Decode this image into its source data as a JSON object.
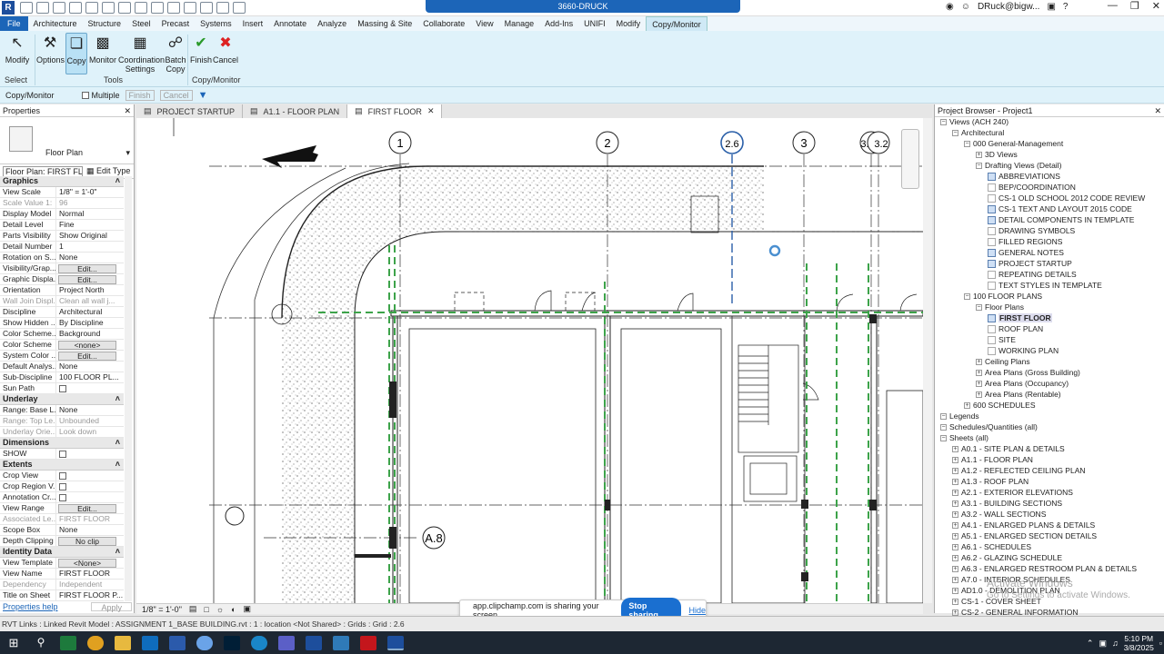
{
  "title_bar": {
    "document": "3660-DRUCK",
    "user": "DRuck@bigw...",
    "revit_letter": "R"
  },
  "ribbon_tabs": [
    "File",
    "Architecture",
    "Structure",
    "Steel",
    "Precast",
    "Systems",
    "Insert",
    "Annotate",
    "Analyze",
    "Massing & Site",
    "Collaborate",
    "View",
    "Manage",
    "Add-Ins",
    "UNIFI",
    "Modify",
    "Copy/Monitor"
  ],
  "ribbon": {
    "modify": "Modify",
    "options": "Options",
    "copy": "Copy",
    "monitor": "Monitor",
    "coordination_settings": "Coordination Settings",
    "batch_copy": "Batch Copy",
    "finish": "Finish",
    "cancel": "Cancel",
    "panel_select": "Select",
    "panel_tools": "Tools",
    "panel_copy_monitor": "Copy/Monitor"
  },
  "options_bar": {
    "label": "Copy/Monitor",
    "multiple": "Multiple",
    "finish": "Finish",
    "cancel": "Cancel"
  },
  "properties": {
    "title": "Properties",
    "type_name": "Floor Plan",
    "selector": "Floor Plan: FIRST FLO",
    "edit_type": "Edit Type",
    "help": "Properties help",
    "apply": "Apply",
    "groups": {
      "graphics": "Graphics",
      "underlay": "Underlay",
      "dimensions": "Dimensions",
      "extents": "Extents",
      "identity": "Identity Data"
    },
    "graphics": [
      [
        "View Scale",
        "1/8\" = 1'-0\""
      ],
      [
        "Scale Value  1:",
        "96"
      ],
      [
        "Display Model",
        "Normal"
      ],
      [
        "Detail Level",
        "Fine"
      ],
      [
        "Parts Visibility",
        "Show Original"
      ],
      [
        "Detail Number",
        "1"
      ],
      [
        "Rotation on S...",
        "None"
      ],
      [
        "Visibility/Grap...",
        "Edit..."
      ],
      [
        "Graphic Displa...",
        "Edit..."
      ],
      [
        "Orientation",
        "Project North"
      ],
      [
        "Wall Join Displ...",
        "Clean all wall j..."
      ],
      [
        "Discipline",
        "Architectural"
      ],
      [
        "Show Hidden ...",
        "By Discipline"
      ],
      [
        "Color Scheme...",
        "Background"
      ],
      [
        "Color Scheme",
        "<none>"
      ],
      [
        "System Color ...",
        "Edit..."
      ],
      [
        "Default Analys...",
        "None"
      ],
      [
        "Sub-Discipline",
        "100 FLOOR PL..."
      ],
      [
        "Sun Path",
        ""
      ]
    ],
    "underlay": [
      [
        "Range: Base L...",
        "None"
      ],
      [
        "Range: Top Le...",
        "Unbounded"
      ],
      [
        "Underlay Orie...",
        "Look down"
      ]
    ],
    "dimensions": [
      [
        "SHOW",
        ""
      ]
    ],
    "extents": [
      [
        "Crop View",
        ""
      ],
      [
        "Crop Region V...",
        ""
      ],
      [
        "Annotation Cr...",
        ""
      ],
      [
        "View Range",
        "Edit..."
      ],
      [
        "Associated Le...",
        "FIRST FLOOR"
      ],
      [
        "Scope Box",
        "None"
      ],
      [
        "Depth Clipping",
        "No clip"
      ]
    ],
    "identity": [
      [
        "View Template",
        "<None>"
      ],
      [
        "View Name",
        "FIRST FLOOR"
      ],
      [
        "Dependency",
        "Independent"
      ],
      [
        "Title on Sheet",
        "FIRST FLOOR P..."
      ]
    ]
  },
  "view_tabs": [
    "PROJECT STARTUP",
    "A1.1 - FLOOR PLAN",
    "FIRST FLOOR"
  ],
  "grid_labels": [
    "1",
    "2",
    "2.6",
    "3",
    "3.1",
    "3.2",
    "A.8"
  ],
  "view_bar": {
    "scale": "1/8\" = 1'-0\""
  },
  "project_browser": {
    "title": "Project Browser - Project1",
    "items": [
      "Views (ACH 240)",
      "Architectural",
      "000 General-Management",
      "3D Views",
      "Drafting Views (Detail)",
      "ABBREVIATIONS",
      "BEP/COORDINATION",
      "CS-1 OLD SCHOOL 2012 CODE REVIEW",
      "CS-1 TEXT AND LAYOUT 2015 CODE",
      "DETAIL COMPONENTS IN TEMPLATE",
      "DRAWING SYMBOLS",
      "FILLED REGIONS",
      "GENERAL NOTES",
      "PROJECT STARTUP",
      "REPEATING DETAILS",
      "TEXT STYLES IN TEMPLATE",
      "100 FLOOR PLANS",
      "Floor Plans",
      "FIRST FLOOR",
      "ROOF PLAN",
      "SITE",
      "WORKING PLAN",
      "Ceiling Plans",
      "Area Plans (Gross Building)",
      "Area Plans (Occupancy)",
      "Area Plans (Rentable)",
      "600 SCHEDULES",
      "Legends",
      "Schedules/Quantities (all)",
      "Sheets (all)",
      "A0.1 - SITE PLAN & DETAILS",
      "A1.1 - FLOOR PLAN",
      "A1.2 - REFLECTED CEILING PLAN",
      "A1.3 - ROOF PLAN",
      "A2.1 - EXTERIOR ELEVATIONS",
      "A3.1 - BUILDING SECTIONS",
      "A3.2 - WALL SECTIONS",
      "A4.1 - ENLARGED PLANS & DETAILS",
      "A5.1 - ENLARGED SECTION DETAILS",
      "A6.1 - SCHEDULES",
      "A6.2 - GLAZING SCHEDULE",
      "A6.3 - ENLARGED RESTROOM PLAN & DETAILS",
      "A7.0 - INTERIOR SCHEDULES",
      "AD1.0 - DEMOLITION PLAN",
      "CS-1 - COVER SHEET",
      "CS-2 - GENERAL INFORMATION"
    ]
  },
  "share": {
    "text": "app.clipchamp.com is sharing your screen.",
    "stop": "Stop sharing",
    "hide": "Hide"
  },
  "status": "RVT Links : Linked Revit Model : ASSIGNMENT 1_BASE BUILDING.rvt : 1 : location <Not Shared> : Grids : Grid : 2.6",
  "watermark": {
    "line1": "Activate Windows",
    "line2": "Go to Settings to activate Windows."
  },
  "clock": {
    "time": "5:10 PM",
    "date": "3/8/2025"
  },
  "colors": {
    "accent": "#1c65b8",
    "ribbon": "#dff2fa",
    "grid_selected": "#2a5fa8",
    "green_dash": "#3da34a"
  }
}
